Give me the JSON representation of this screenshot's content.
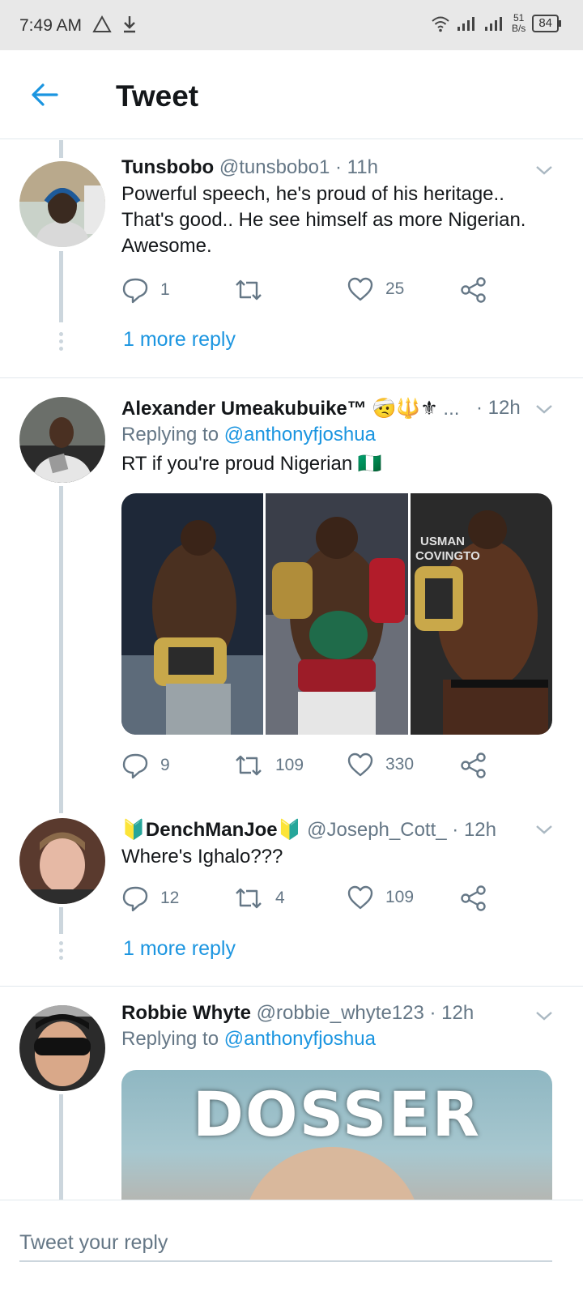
{
  "status_bar": {
    "time": "7:49 AM",
    "left_icons": [
      "alert-triangle-icon",
      "download-icon"
    ],
    "speed_top": "51",
    "speed_bottom": "B/s",
    "battery": "84"
  },
  "header": {
    "back_icon": "back-arrow-icon",
    "title": "Tweet"
  },
  "colors": {
    "accent": "#1b95e0",
    "muted": "#657786",
    "divider": "#e1e8ed",
    "thread_line": "#ccd6dd"
  },
  "tweets": [
    {
      "name": "Tunsbobo",
      "handle": "@tunsbobo1",
      "time": "· 11h",
      "text_lines": [
        "Powerful speech, he's proud of his heritage..",
        "That's good.. He see himself as more Nigerian.",
        "Awesome."
      ],
      "replies": "1",
      "retweets": "",
      "likes": "25",
      "more_reply": "1 more reply"
    },
    {
      "name": "Alexander Umeakubuike™ 🤕🔱⚜",
      "handle": "...",
      "time": "· 12h",
      "replying_prefix": "Replying to",
      "replying_handle": "@anthonyfjoshua",
      "text": "RT if you're proud Nigerian 🇳🇬",
      "media_text": [
        "USMAN",
        "COVINGTO"
      ],
      "replies": "9",
      "retweets": "109",
      "likes": "330"
    },
    {
      "name": "🔰DenchManJoe🔰",
      "handle": "@Joseph_Cott_",
      "time": "· 12h",
      "text": "Where's Ighalo???",
      "replies": "12",
      "retweets": "4",
      "likes": "109",
      "more_reply": "1 more reply"
    },
    {
      "name": "Robbie Whyte",
      "handle": "@robbie_whyte123",
      "time": "· 12h",
      "replying_prefix": "Replying to",
      "replying_handle": "@anthonyfjoshua",
      "gif_text": "DOSSER"
    }
  ],
  "reply_bar": {
    "placeholder": "Tweet your reply"
  }
}
